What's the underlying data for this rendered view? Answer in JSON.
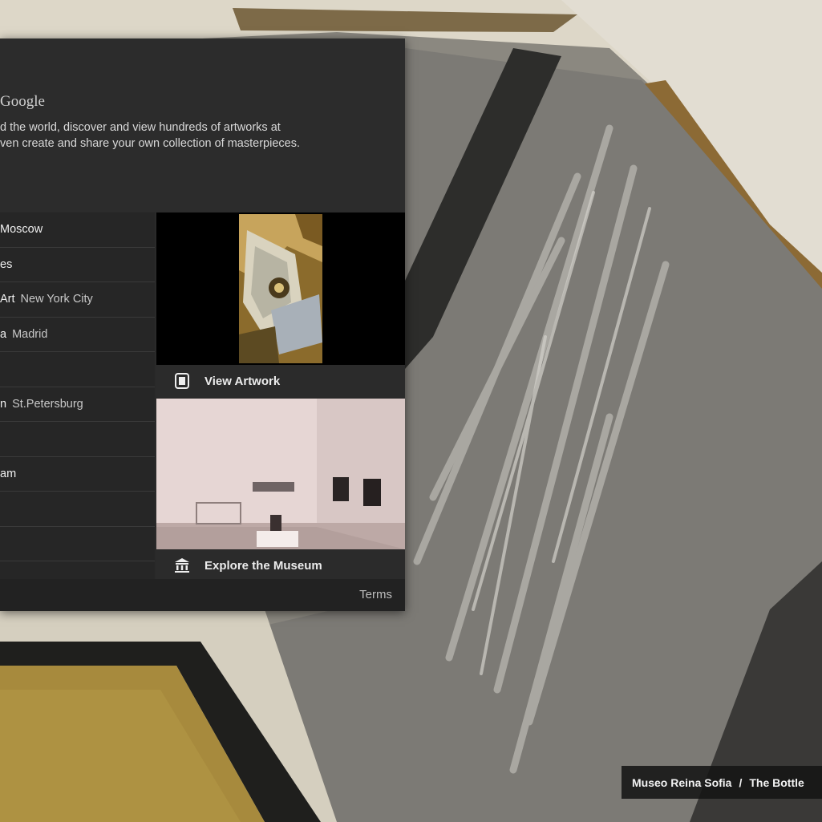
{
  "brand": {
    "text": "Google"
  },
  "intro": {
    "line1": "d the world, discover and view hundreds of artworks at",
    "line2": "ven create and share your own collection of masterpieces."
  },
  "museums": [
    {
      "name": "Moscow",
      "city": ""
    },
    {
      "name": "es",
      "city": ""
    },
    {
      "name": "Art",
      "city": "New York City"
    },
    {
      "name": "a",
      "city": "Madrid"
    },
    {
      "name": "",
      "city": ""
    },
    {
      "name": "n",
      "city": "St.Petersburg"
    },
    {
      "name": "",
      "city": ""
    },
    {
      "name": "am",
      "city": ""
    },
    {
      "name": "",
      "city": ""
    },
    {
      "name": "",
      "city": ""
    }
  ],
  "artwork_action": {
    "label": "View Artwork",
    "icon": "artwork-frame-icon"
  },
  "museum_action": {
    "label": "Explore the Museum",
    "icon": "museum-building-icon"
  },
  "footer": {
    "terms": "Terms"
  },
  "caption": {
    "museum": "Museo Reina Sofia",
    "separator": "/",
    "title": "The Bottle"
  },
  "colors": {
    "panel": "#2a2a2a",
    "list": "#262626",
    "accent_text": "#ececec"
  }
}
